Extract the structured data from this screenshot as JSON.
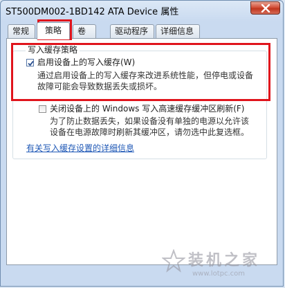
{
  "window": {
    "title": "ST500DM002-1BD142 ATA Device 属性",
    "close_icon": "close-icon"
  },
  "tabs": [
    {
      "label": "常规",
      "active": false
    },
    {
      "label": "策略",
      "active": true
    },
    {
      "label": "卷",
      "active": false
    },
    {
      "label": "驱动程序",
      "active": false
    },
    {
      "label": "详细信息",
      "active": false
    }
  ],
  "write_cache": {
    "group_title": "写入缓存策略",
    "enable_option": {
      "label": "启用设备上的写入缓存(W)",
      "checked": true,
      "description_line1": "通过启用设备上的写入缓存来改进系统性能，但停电或设备",
      "description_line2": "故障可能会导致数据丢失或损坏。"
    },
    "flush_option": {
      "label": "关闭设备上的 Windows 写入高速缓存缓冲区刷新(F)",
      "checked": false,
      "description_line1": "为了防止数据丢失，如果设备没有单独的电源以允许该",
      "description_line2": "设备在电源故障时刷新其缓冲区，请勿选中此复选框。"
    }
  },
  "details_link": "有关写入缓存设置的详细信息",
  "watermark": {
    "brand": "装机之家",
    "site": "www.lotpc.com"
  },
  "colors": {
    "highlight": "#e0141c",
    "link": "#1f58b6"
  }
}
